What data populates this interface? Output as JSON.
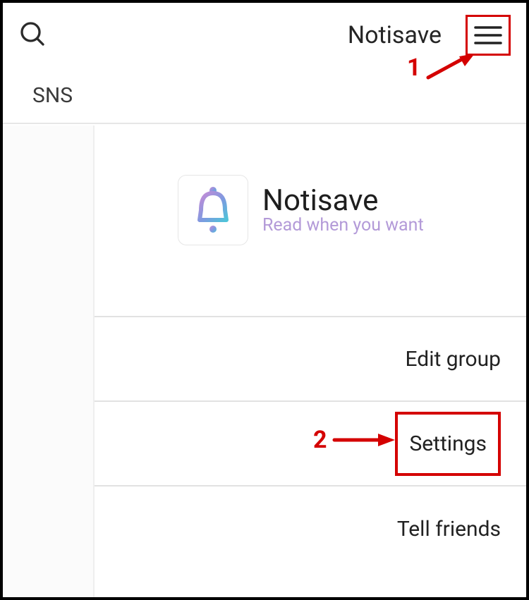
{
  "header": {
    "title": "Notisave"
  },
  "tabs": {
    "items": [
      "SNS"
    ]
  },
  "brand": {
    "title": "Notisave",
    "subtitle": "Read when you want"
  },
  "menu": {
    "items": [
      {
        "label": "Edit group"
      },
      {
        "label": "Settings"
      },
      {
        "label": "Tell friends"
      }
    ]
  },
  "annotations": {
    "one": "1",
    "two": "2"
  }
}
